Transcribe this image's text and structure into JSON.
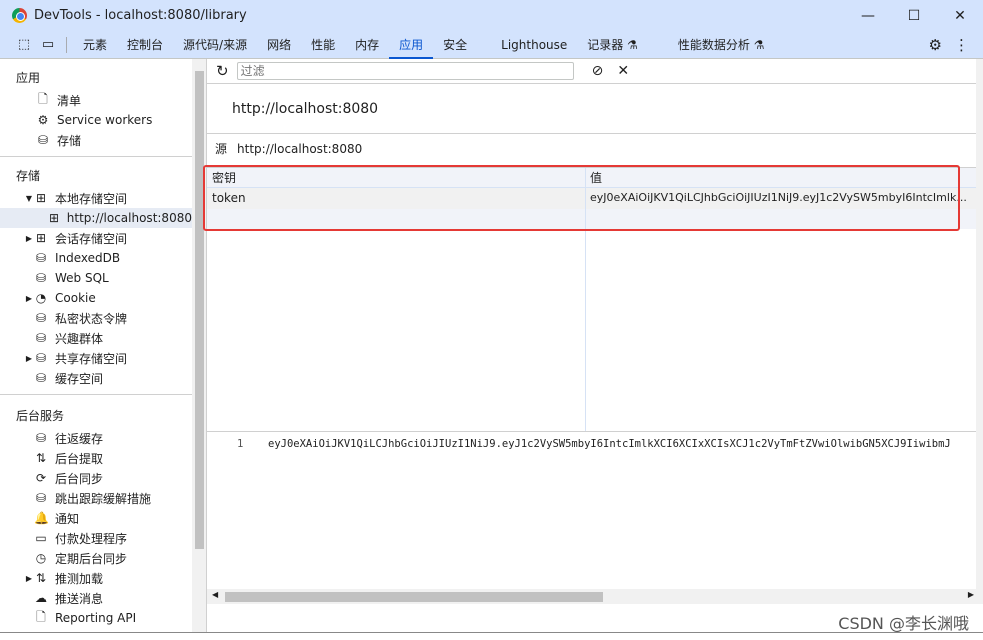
{
  "window": {
    "title": "DevTools - localhost:8080/library",
    "minimize": "—",
    "maximize": "☐",
    "close": "✕"
  },
  "tabs": [
    "元素",
    "控制台",
    "源代码/来源",
    "网络",
    "性能",
    "内存",
    "应用",
    "安全",
    "Lighthouse",
    "记录器 ⚗",
    "性能数据分析 ⚗"
  ],
  "active_tab": "应用",
  "accent": "#0b57d0",
  "sidebar": {
    "app_section": "应用",
    "app_items": [
      {
        "label": "清单",
        "icon": "file-icon"
      },
      {
        "label": "Service workers",
        "icon": "gears-icon"
      },
      {
        "label": "存储",
        "icon": "database-icon"
      }
    ],
    "storage_section": "存储",
    "storage_items": [
      {
        "label": "本地存储空间",
        "icon": "table-icon",
        "arrow": "▼"
      },
      {
        "label": "http://localhost:8080",
        "icon": "table-icon",
        "arrow": ""
      },
      {
        "label": "会话存储空间",
        "icon": "table-icon",
        "arrow": "▶"
      },
      {
        "label": "IndexedDB",
        "icon": "database-icon",
        "arrow": ""
      },
      {
        "label": "Web SQL",
        "icon": "database-icon",
        "arrow": ""
      },
      {
        "label": "Cookie",
        "icon": "cookie-icon",
        "arrow": "▶"
      },
      {
        "label": "私密状态令牌",
        "icon": "database-icon",
        "arrow": ""
      },
      {
        "label": "兴趣群体",
        "icon": "database-icon",
        "arrow": ""
      },
      {
        "label": "共享存储空间",
        "icon": "database-icon",
        "arrow": "▶"
      },
      {
        "label": "缓存空间",
        "icon": "database-icon",
        "arrow": ""
      }
    ],
    "bg_section": "后台服务",
    "bg_items": [
      {
        "label": "往返缓存",
        "icon": "database-icon",
        "arrow": ""
      },
      {
        "label": "后台提取",
        "icon": "sync-arrows-icon",
        "arrow": ""
      },
      {
        "label": "后台同步",
        "icon": "sync-icon",
        "arrow": ""
      },
      {
        "label": "跳出跟踪缓解措施",
        "icon": "database-icon",
        "arrow": ""
      },
      {
        "label": "通知",
        "icon": "bell-icon",
        "arrow": ""
      },
      {
        "label": "付款处理程序",
        "icon": "card-icon",
        "arrow": ""
      },
      {
        "label": "定期后台同步",
        "icon": "clock-icon",
        "arrow": ""
      },
      {
        "label": "推测加载",
        "icon": "sync-arrows-icon",
        "arrow": "▶"
      },
      {
        "label": "推送消息",
        "icon": "cloud-icon",
        "arrow": ""
      },
      {
        "label": "Reporting API",
        "icon": "file-icon",
        "arrow": ""
      }
    ]
  },
  "main": {
    "filter_placeholder": "过滤",
    "origin": "http://localhost:8080",
    "origin_label": "源",
    "origin_value": "http://localhost:8080",
    "columns": [
      "密钥",
      "值"
    ],
    "rows": [
      {
        "key": "token",
        "value": "eyJ0eXAiOiJKV1QiLCJhbGciOiJIUzI1NiJ9.eyJ1c2VySW5mbyI6IntcImlk..."
      }
    ],
    "preview_line": "1",
    "preview_text": "eyJ0eXAiOiJKV1QiLCJhbGciOiJIUzI1NiJ9.eyJ1c2VySW5mbyI6IntcImlkXCI6XCIxXCIsXCJ1c2VyTmFtZVwiOlwibGN5XCJ9IiwibmJ"
  },
  "watermark": "CSDN @李长渊哦"
}
